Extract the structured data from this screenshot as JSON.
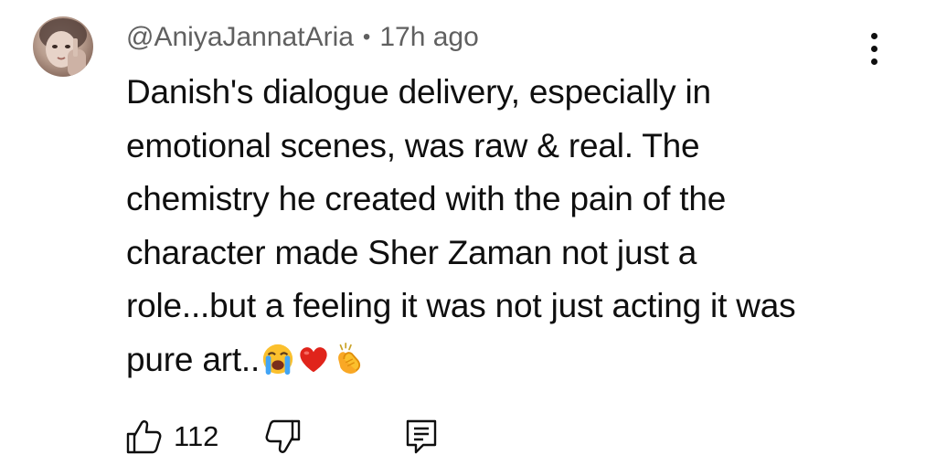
{
  "comment": {
    "author": "@AniyaJannatAria",
    "separator": "•",
    "time": "17h ago",
    "text_lines": [
      "Danish's dialogue delivery, especially in",
      "emotional scenes, was raw & real. The",
      "chemistry he created with the pain of the",
      "character made Sher Zaman not just a",
      "role...but a feeling it was not just acting it was",
      "pure art.."
    ],
    "emojis": [
      "loudly-crying-face",
      "red-heart",
      "clapping-hands"
    ],
    "like_count": "112"
  },
  "icons": {
    "menu": "more-vert-icon",
    "like": "thumb-up-icon",
    "dislike": "thumb-down-icon",
    "reply": "reply-comment-icon"
  },
  "colors": {
    "text": "#0f0f0f",
    "meta": "#606060",
    "heart": "#e0241b",
    "emoji_yellow": "#fbc02d"
  }
}
